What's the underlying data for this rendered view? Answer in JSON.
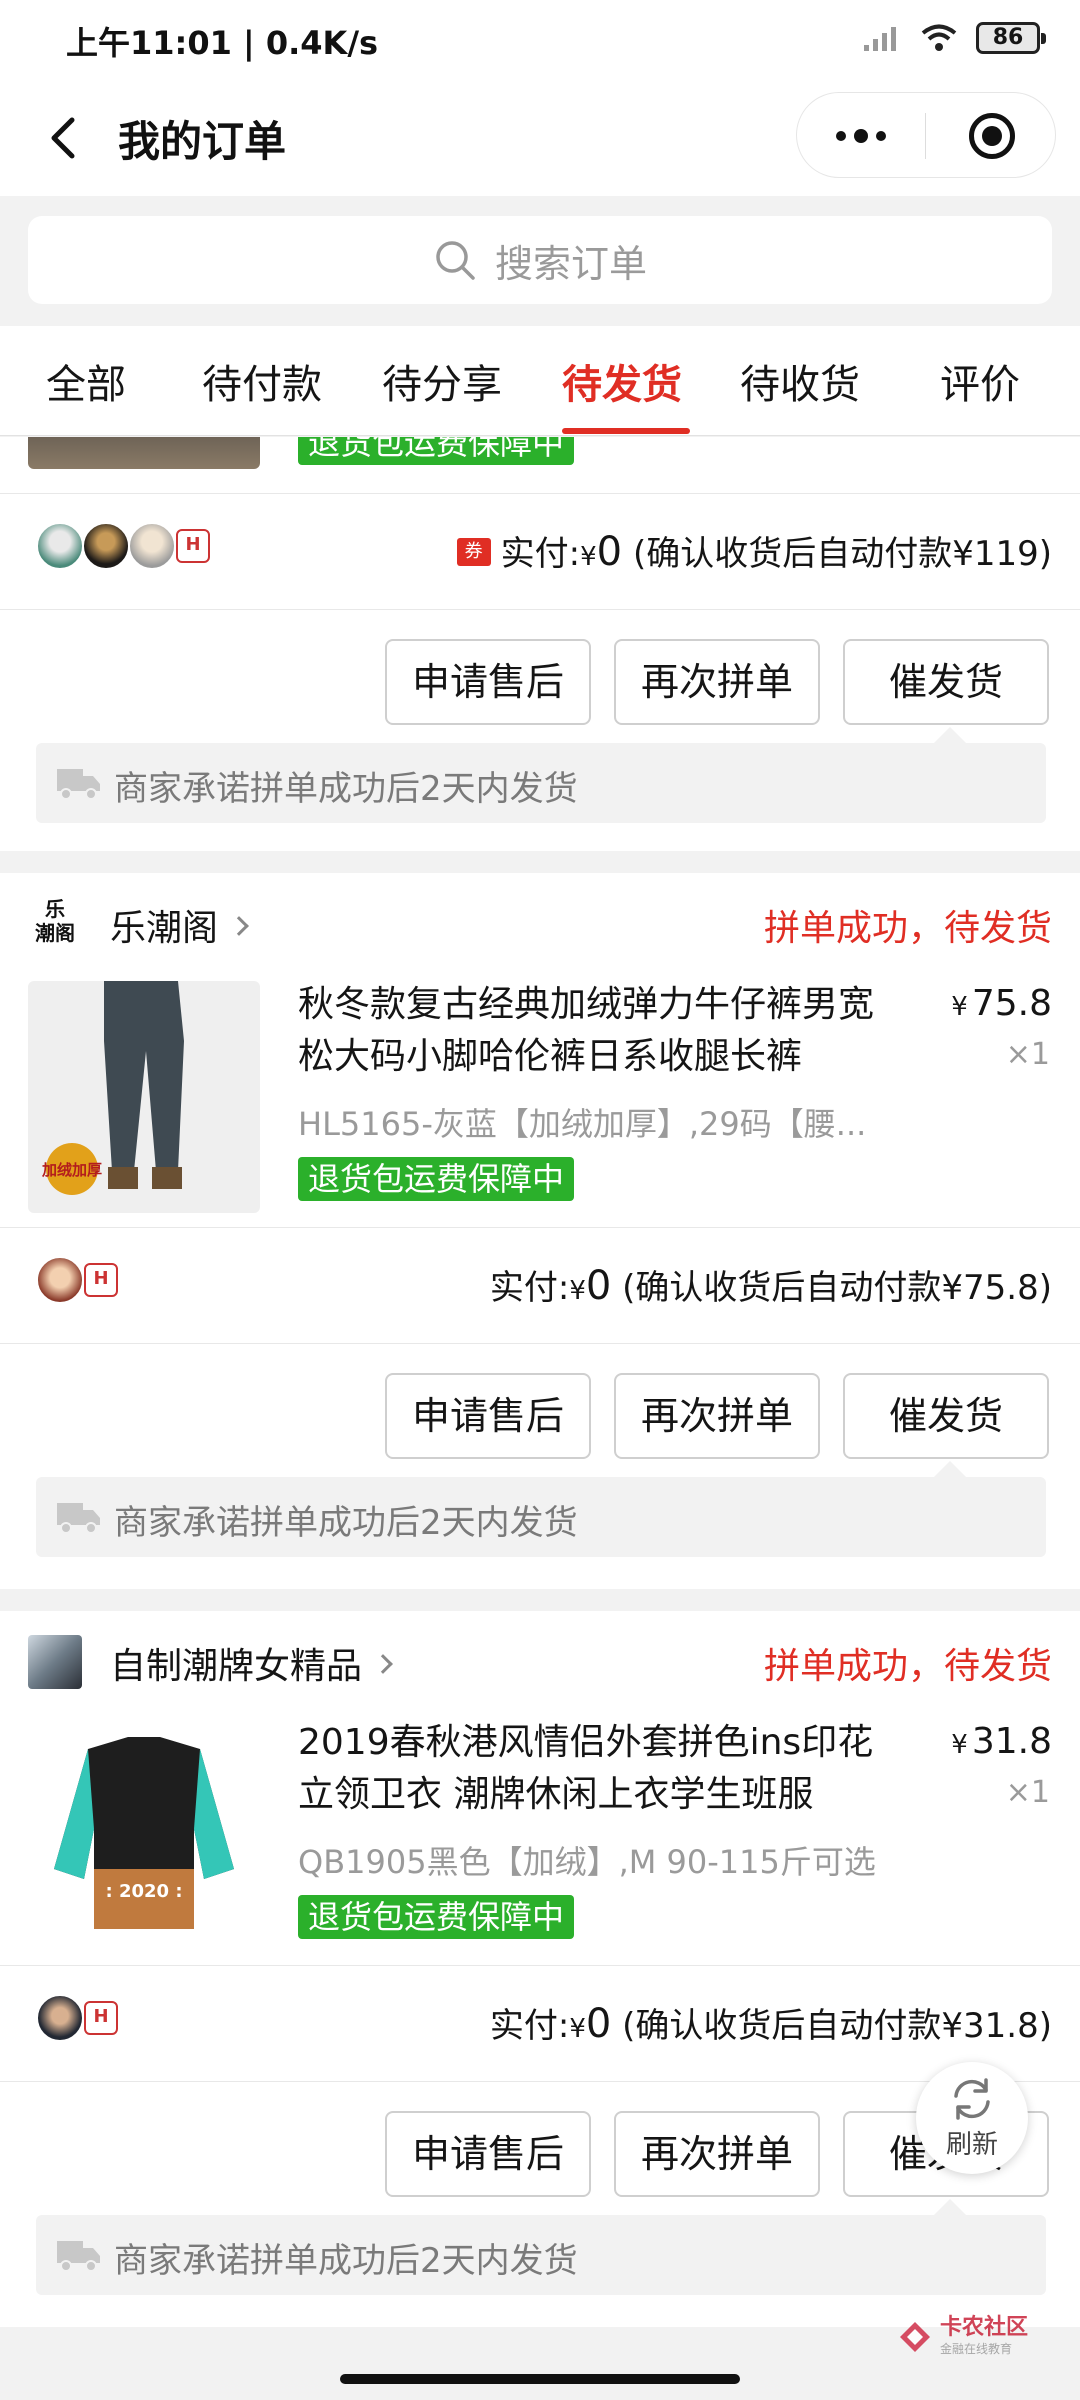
{
  "status_bar": {
    "time_speed": "上午11:01 | 0.4K/s",
    "battery": "86"
  },
  "header": {
    "title": "我的订单"
  },
  "search": {
    "placeholder": "搜索订单"
  },
  "tabs": [
    "全部",
    "待付款",
    "待分享",
    "待发货",
    "待收货",
    "评价"
  ],
  "active_tab": "待发货",
  "partial_order": {
    "badge": "退货包运费保障中",
    "coupon": "券",
    "pay_label": "实付:",
    "currency": "¥",
    "paid": "0",
    "pay_note": "(确认收货后自动付款¥119)",
    "promise": "商家承诺拼单成功后2天内发货"
  },
  "orders": [
    {
      "shop_logo_text": "乐\n潮阁",
      "shop_name": "乐潮阁",
      "status": "拼单成功，待发货",
      "title": "秋冬款复古经典加绒弹力牛仔裤男宽松大码小脚哈伦裤日系收腿长裤",
      "price": "75.8",
      "qty": "×1",
      "spec": "HL5165-灰蓝【加绒加厚】,29码【腰...",
      "badge": "退货包运费保障中",
      "image_badge": "加绒加厚",
      "pay_label": "实付:",
      "currency": "¥",
      "paid": "0",
      "pay_note": "(确认收货后自动付款¥75.8)",
      "promise": "商家承诺拼单成功后2天内发货"
    },
    {
      "shop_name": "自制潮牌女精品",
      "status": "拼单成功，待发货",
      "title": "2019春秋港风情侣外套拼色ins印花立领卫衣 潮牌休闲上衣学生班服",
      "price": "31.8",
      "qty": "×1",
      "spec": "QB1905黑色【加绒】,M 90-115斤可选",
      "badge": "退货包运费保障中",
      "image_text": ": 2020 :",
      "pay_label": "实付:",
      "currency": "¥",
      "paid": "0",
      "pay_note": "(确认收货后自动付款¥31.8)",
      "promise": "商家承诺拼单成功后2天内发货"
    }
  ],
  "buttons": {
    "after_sale": "申请售后",
    "regroup": "再次拼单",
    "urge": "催发货"
  },
  "refresh": {
    "label": "刷新"
  },
  "watermark": {
    "name": "卡农社区",
    "sub": "金融在线教育"
  },
  "colors": {
    "accent": "#e02e24",
    "badge_green": "#2bb02b",
    "muted": "#9a9a9a"
  }
}
